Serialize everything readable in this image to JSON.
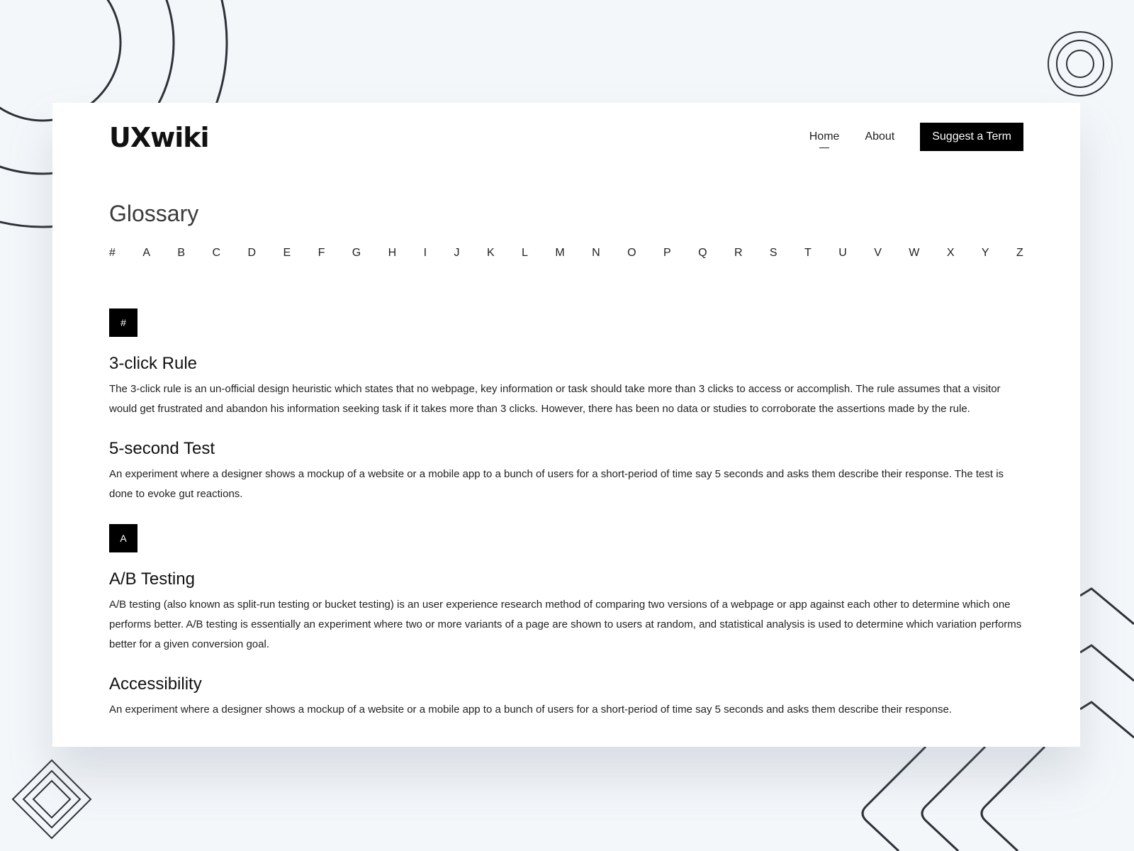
{
  "colors": {
    "background": "#f4f7fa",
    "card": "#ffffff",
    "accent": "#000000",
    "deco_stroke": "#2e3238"
  },
  "header": {
    "logo": "UXwiki",
    "nav": [
      {
        "label": "Home",
        "active": true
      },
      {
        "label": "About",
        "active": false
      }
    ],
    "cta_label": "Suggest a Term"
  },
  "page_title": "Glossary",
  "alphabet": [
    "#",
    "A",
    "B",
    "C",
    "D",
    "E",
    "F",
    "G",
    "H",
    "I",
    "J",
    "K",
    "L",
    "M",
    "N",
    "O",
    "P",
    "Q",
    "R",
    "S",
    "T",
    "U",
    "V",
    "W",
    "X",
    "Y",
    "Z"
  ],
  "sections": [
    {
      "letter": "#",
      "terms": [
        {
          "title": "3-click Rule",
          "description": "The 3-click rule is an un-official design heuristic which states that no webpage, key information or task should take more than 3 clicks to access or accomplish. The rule assumes that a visitor would get frustrated and abandon his information seeking task if it takes more than 3 clicks. However, there has been no data or studies to corroborate the assertions made by the rule."
        },
        {
          "title": "5-second Test",
          "description": "An experiment where a designer shows a mockup of a website or a mobile app to a bunch of users for a short-period of time say 5 seconds and asks them describe their response. The test is done to evoke gut reactions."
        }
      ]
    },
    {
      "letter": "A",
      "terms": [
        {
          "title": "A/B Testing",
          "description": "A/B testing (also known as split-run testing or bucket testing) is an user experience research method of comparing two versions of a webpage or app against each other to determine which one performs better. A/B testing is essentially an experiment where two or more variants of a page are shown to users at random, and statistical analysis is used to determine which variation performs better for a given conversion goal."
        },
        {
          "title": "Accessibility",
          "description": "An experiment where a designer shows a mockup of a website or a mobile app to a bunch of users for a short-period of time say 5 seconds and asks them describe their response."
        }
      ]
    }
  ]
}
